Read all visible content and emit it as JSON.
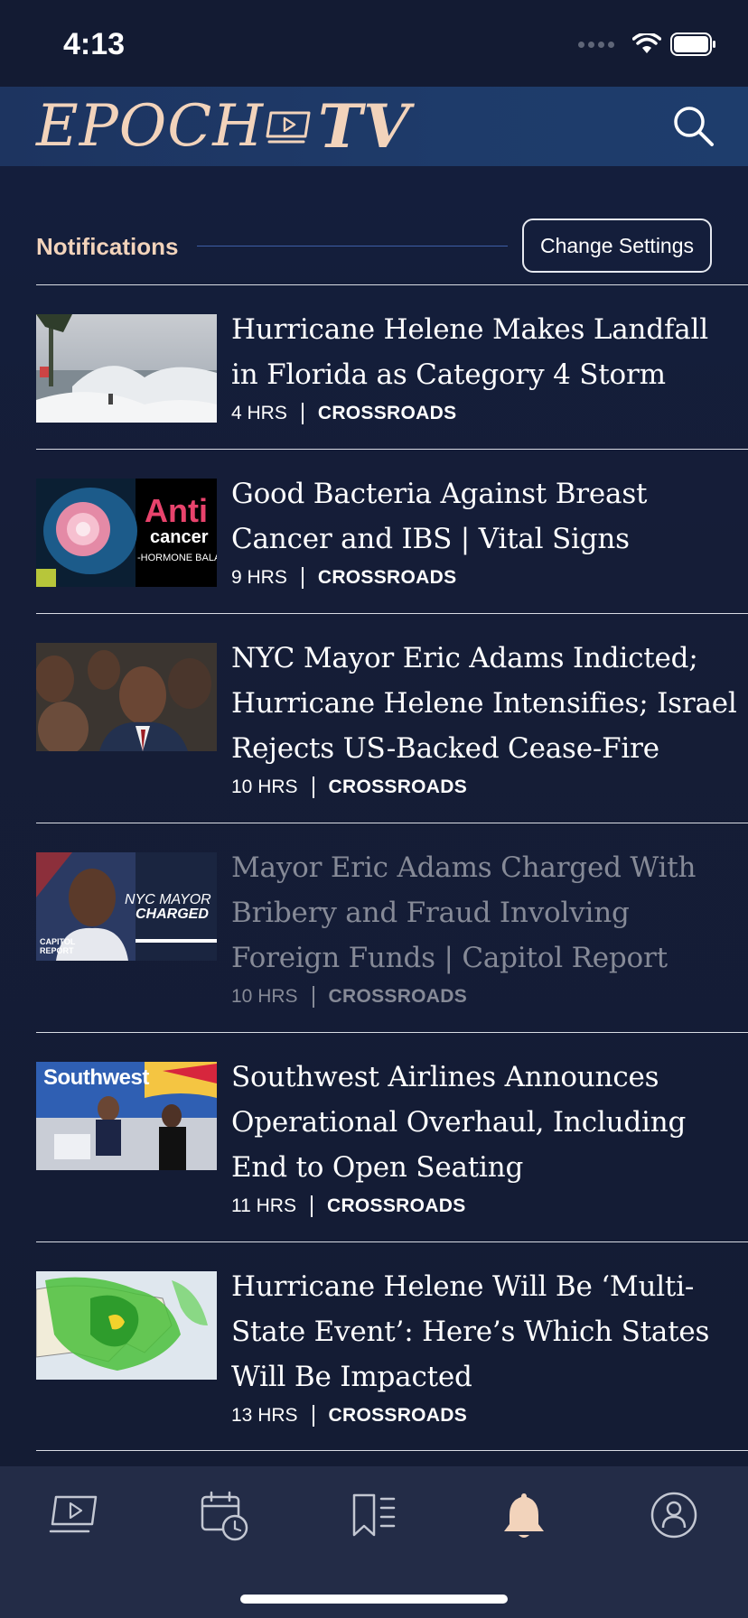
{
  "status_bar": {
    "time": "4:13"
  },
  "header": {
    "logo_left": "EPOCH",
    "logo_right": "TV",
    "brand_color": "#f2d3bb",
    "search_icon": "search-icon"
  },
  "notifications": {
    "title": "Notifications",
    "change_settings_label": "Change Settings"
  },
  "items": [
    {
      "title": "Hurricane Helene Makes Landfall in Florida as Category 4 Storm",
      "time": "4 HRS",
      "show": "CROSSROADS",
      "watched": false
    },
    {
      "title": "Good Bacteria Against Breast Cancer and IBS | Vital Signs",
      "time": "9 HRS",
      "show": "CROSSROADS",
      "watched": false,
      "thumb_text": {
        "line1": "Anti",
        "line2": "cancer",
        "line3": "-HORMONE BALANCE-"
      }
    },
    {
      "title": "NYC Mayor Eric Adams Indicted; Hurricane Helene Intensifies; Israel Rejects US-Backed Cease-Fire",
      "time": "10 HRS",
      "show": "CROSSROADS",
      "watched": false
    },
    {
      "title": "Mayor Eric Adams Charged With Bribery and Fraud Involving Foreign Funds | Capitol Report",
      "time": "10 HRS",
      "show": "CROSSROADS",
      "watched": true,
      "thumb_text": {
        "line1": "NYC MAYOR",
        "line2": "CHARGED",
        "line3": "CAPITOL REPORT"
      }
    },
    {
      "title": "Southwest Airlines Announces Operational Overhaul, Including End to Open Seating",
      "time": "11 HRS",
      "show": "CROSSROADS",
      "watched": false,
      "thumb_text": {
        "line1": "Southwest"
      }
    },
    {
      "title": "Hurricane Helene Will Be ‘Multi-State Event’: Here’s Which States Will Be Impacted",
      "time": "13 HRS",
      "show": "CROSSROADS",
      "watched": false
    }
  ],
  "tabbar": {
    "tabs": [
      "video-icon",
      "schedule-icon",
      "saved-icon",
      "notifications-icon",
      "profile-icon"
    ],
    "active_tab": "notifications-icon"
  }
}
